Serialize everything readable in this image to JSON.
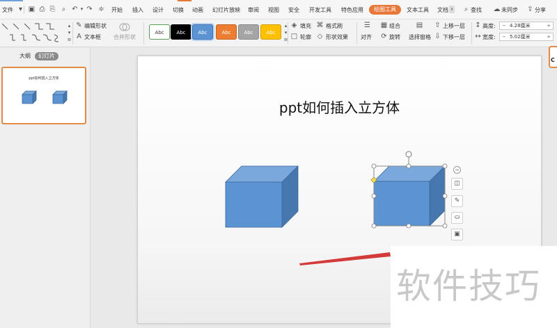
{
  "menubar": {
    "file_label": "文件",
    "tabs": [
      "开始",
      "插入",
      "设计",
      "切换",
      "动画",
      "幻灯片放映",
      "审阅",
      "视图",
      "安全",
      "开发工具",
      "特色应用"
    ],
    "active_tab": "绘图工具",
    "text_tool_tab": "文本工具",
    "truncated_tab": "文档",
    "search_label": "查找",
    "sync_label": "未同步",
    "share_label": "分享",
    "colors": {
      "active_tab_bg": "#e8773a",
      "accent": "#6fa0d8"
    }
  },
  "ribbon": {
    "edit_shape": "编辑形状",
    "textbox": "文本框",
    "merge_shape": "合并形状",
    "style_swatches": [
      {
        "label": "Abc",
        "bg": "#ffffff",
        "fg": "#333333",
        "border": "#5b9a5b"
      },
      {
        "label": "Abc",
        "bg": "#000000",
        "fg": "#ffffff",
        "border": "#000000"
      },
      {
        "label": "Abc",
        "bg": "#5b93d3",
        "fg": "#ffffff",
        "border": "#3f73b1"
      },
      {
        "label": "Abc",
        "bg": "#ec7d31",
        "fg": "#ffffff",
        "border": "#c4621e"
      },
      {
        "label": "Abc",
        "bg": "#a5a5a5",
        "fg": "#ffffff",
        "border": "#888888"
      },
      {
        "label": "Abc",
        "bg": "#ffc000",
        "fg": "#ffffff",
        "border": "#d49f00"
      }
    ],
    "fill": "填充",
    "format_painter": "格式刷",
    "outline": "轮廓",
    "shape_effects": "形状效果",
    "align": "对齐",
    "group": "组合",
    "rotate": "旋转",
    "selection_pane": "选择窗格",
    "bring_forward": "上移一层",
    "send_backward": "下移一层",
    "height_label": "高度:",
    "height_value": "4.28厘米",
    "width_label": "宽度:",
    "width_value": "5.02厘米"
  },
  "leftpanel": {
    "outline_tab": "大纲",
    "slides_tab": "幻灯片",
    "thumb_title": "ppt如何插入立方体"
  },
  "slide": {
    "title": "ppt如何插入立方体",
    "cube_colors": {
      "front": "#5b93d3",
      "top": "#7aa8dc",
      "side": "#4677ae",
      "edge": "#3d6899"
    }
  },
  "watermark": {
    "text": "软件技巧"
  },
  "corner_widget": {
    "text": "C"
  }
}
